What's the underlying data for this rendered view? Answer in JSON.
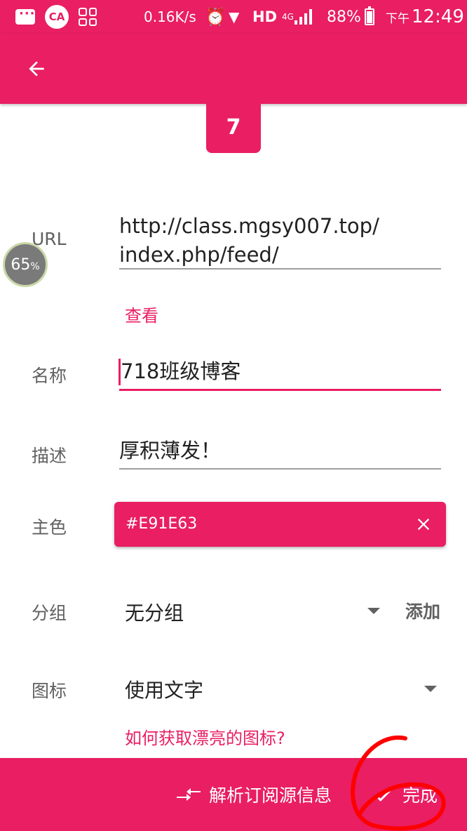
{
  "status_bar": {
    "net_speed": "0.16K/s",
    "hd_label": "HD",
    "network_label": "4G",
    "battery_percent": "88%",
    "time_prefix": "下午",
    "time": "12:49",
    "app_badge": "CA"
  },
  "preview": {
    "letter": "7"
  },
  "speed_badge": {
    "value": "65",
    "unit": "%"
  },
  "form": {
    "url": {
      "label": "URL",
      "line1": "http://class.mgsy007.top/",
      "line2": "index.php/feed/"
    },
    "view_link": "查看",
    "name": {
      "label": "名称",
      "value": "718班级博客"
    },
    "description": {
      "label": "描述",
      "value": "厚积薄发！"
    },
    "color": {
      "label": "主色",
      "value": "#E91E63"
    },
    "group": {
      "label": "分组",
      "value": "无分组",
      "add_label": "添加"
    },
    "icon": {
      "label": "图标",
      "value": "使用文字"
    },
    "icon_help_link": "如何获取漂亮的图标?"
  },
  "bottom_bar": {
    "parse_label": "解析订阅源信息",
    "done_label": "完成"
  },
  "annotation": {
    "text": "6",
    "color": "#FF0000"
  },
  "colors": {
    "accent": "#E91E63",
    "label_gray": "#616161"
  }
}
